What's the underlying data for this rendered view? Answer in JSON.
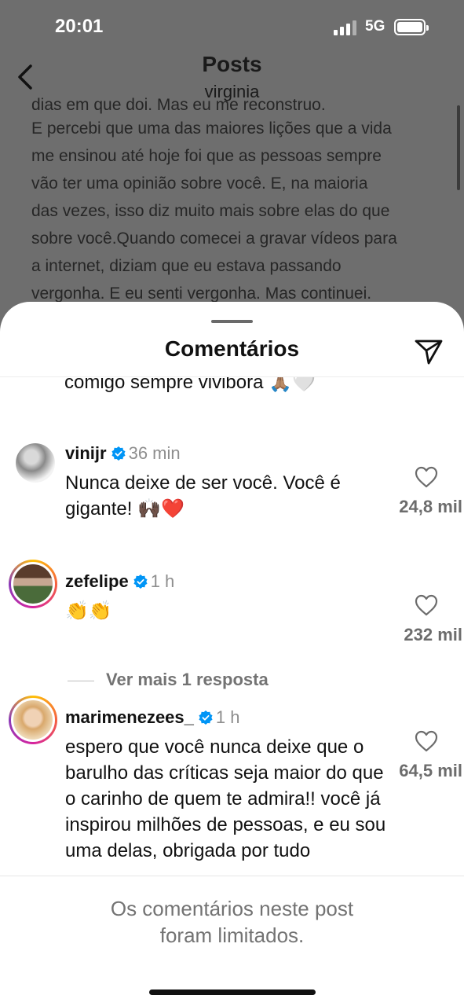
{
  "status": {
    "time": "20:01",
    "network": "5G"
  },
  "nav": {
    "title": "Posts",
    "subtitle": "virginia"
  },
  "caption": {
    "cut_line": "dias em que doi. Mas eu me reconstruo.",
    "lines": [
      "E percebi que uma das maiores lições que a vida",
      "me ensinou até hoje foi que as pessoas sempre",
      "vão ter uma opinião sobre você. E, na maioria",
      "das vezes, isso diz muito mais sobre elas do que",
      "sobre você.Quando comecei a gravar vídeos para",
      "a internet, diziam que eu estava passando",
      "vergonha. E eu senti vergonha. Mas continuei."
    ]
  },
  "sheet": {
    "title": "Comentários"
  },
  "previous_comment_tail": "comigo sempre vivibora 🙏🏽🤍",
  "comments": [
    {
      "username": "vinijr",
      "time": "36 min",
      "text": "Nunca deixe de ser você. Você é gigante! 🙌🏿❤️",
      "likes": "24,8 mil"
    },
    {
      "username": "zefelipe",
      "time": "1 h",
      "text": "👏👏",
      "likes": "232 mil"
    },
    {
      "username": "marimenezees_",
      "time": "1 h",
      "text": "espero que você nunca deixe que o barulho das críticas seja maior do que o carinho de quem te admira!! você já inspirou milhões de pessoas, e eu sou uma delas, obrigada por tudo",
      "likes": "64,5 mil"
    }
  ],
  "more_replies": "Ver mais 1 resposta",
  "footer": {
    "line1": "Os comentários neste post",
    "line2": "foram limitados."
  },
  "icons": {
    "back": "chevron-left-icon",
    "share": "paper-plane-icon",
    "like": "heart-outline-icon",
    "verified": "verified-badge-icon"
  },
  "colors": {
    "verified": "#0095f6",
    "muted": "#737373"
  }
}
